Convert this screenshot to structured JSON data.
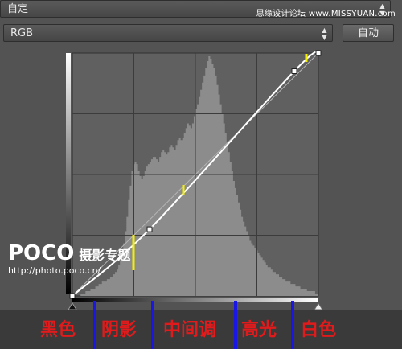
{
  "preset": {
    "value": "自定",
    "arrows": "▲▼"
  },
  "watermark": "思缘设计论坛 www.MISSYUAN.com",
  "channel": {
    "value": "RGB",
    "arrows": "▲▼"
  },
  "auto_button": "自动",
  "brand": {
    "logo": "POCO",
    "sub": "摄影专题",
    "url": "http://photo.poco.cn/"
  },
  "zones": [
    "黑色",
    "阴影",
    "中间调",
    "高光",
    "白色"
  ],
  "colors": {
    "zone_text": "#e11b1b",
    "divider": "#1a17e6",
    "marker": "#f5f000",
    "curve": "#ffffff",
    "histogram": "#8c8c8c"
  },
  "curve": {
    "points": [
      {
        "input": 0,
        "output": 0
      },
      {
        "input": 80,
        "output": 70
      },
      {
        "input": 230,
        "output": 236
      },
      {
        "input": 255,
        "output": 255
      }
    ]
  },
  "histogram": [
    0,
    0,
    0,
    0,
    0,
    1,
    1,
    1,
    2,
    2,
    2,
    3,
    3,
    3,
    4,
    4,
    5,
    5,
    6,
    6,
    6,
    7,
    7,
    8,
    8,
    9,
    10,
    11,
    13,
    15,
    18,
    22,
    27,
    33,
    40,
    46,
    52,
    55,
    56,
    55,
    52,
    50,
    49,
    50,
    52,
    54,
    55,
    56,
    57,
    58,
    58,
    57,
    56,
    58,
    60,
    61,
    60,
    59,
    60,
    62,
    63,
    62,
    61,
    63,
    65,
    66,
    65,
    66,
    68,
    70,
    72,
    71,
    70,
    72,
    75,
    78,
    80,
    83,
    86,
    89,
    92,
    95,
    98,
    100,
    99,
    97,
    95,
    92,
    88,
    84,
    80,
    76,
    72,
    68,
    64,
    60,
    56,
    52,
    48,
    45,
    42,
    39,
    36,
    33,
    31,
    29,
    27,
    25,
    23,
    22,
    21,
    20,
    19,
    18,
    17,
    16,
    15,
    14,
    13,
    12,
    12,
    11,
    10,
    10,
    9,
    9,
    8,
    8,
    7,
    7,
    6,
    6,
    6,
    5,
    5,
    5,
    4,
    4,
    4,
    3,
    3,
    3,
    3,
    2,
    2,
    2,
    2,
    2,
    1,
    1
  ]
}
